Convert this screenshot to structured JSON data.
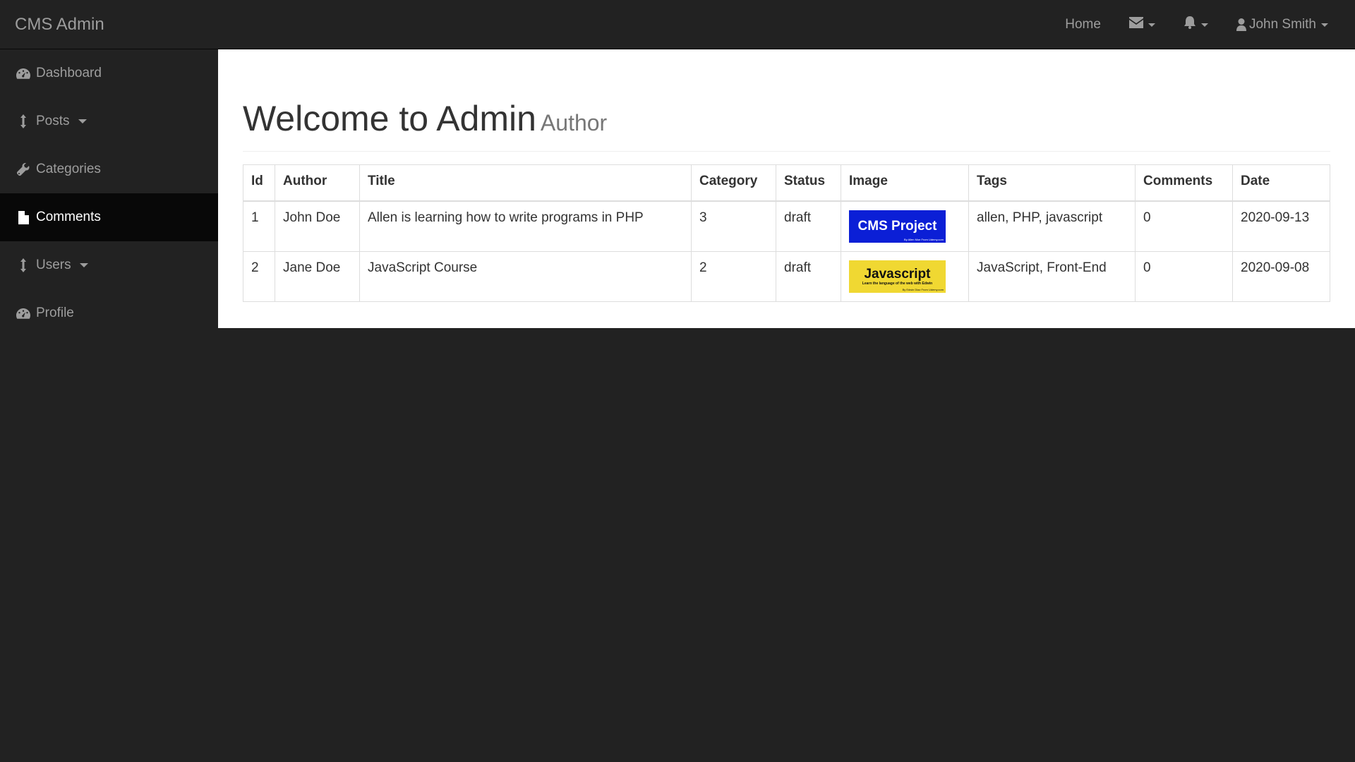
{
  "navbar": {
    "brand": "CMS Admin",
    "home": "Home",
    "messages_icon": "envelope-icon",
    "alerts_icon": "bell-icon",
    "user_icon": "user-icon",
    "user_name": "John Smith"
  },
  "sidebar": {
    "items": [
      {
        "label": "Dashboard",
        "icon": "dashboard-icon",
        "dropdown": false,
        "active": false
      },
      {
        "label": "Posts",
        "icon": "arrows-v-icon",
        "dropdown": true,
        "active": false
      },
      {
        "label": "Categories",
        "icon": "wrench-icon",
        "dropdown": false,
        "active": false
      },
      {
        "label": "Comments",
        "icon": "file-icon",
        "dropdown": false,
        "active": true
      },
      {
        "label": "Users",
        "icon": "arrows-v-icon",
        "dropdown": true,
        "active": false
      },
      {
        "label": "Profile",
        "icon": "dashboard-icon",
        "dropdown": false,
        "active": false
      }
    ]
  },
  "page": {
    "title": "Welcome to Admin",
    "subtitle": "Author"
  },
  "table": {
    "headers": [
      "Id",
      "Author",
      "Title",
      "Category",
      "Status",
      "Image",
      "Tags",
      "Comments",
      "Date"
    ],
    "rows": [
      {
        "id": "1",
        "author": "John Doe",
        "title": "Allen is learning how to write programs in PHP",
        "category": "3",
        "status": "draft",
        "image": {
          "title": "CMS Project",
          "sub": "",
          "tiny": "By Allen Moe From Udemy.com",
          "color": "#0b1fd6"
        },
        "tags": "allen, PHP, javascript",
        "comments": "0",
        "date": "2020-09-13"
      },
      {
        "id": "2",
        "author": "Jane Doe",
        "title": "JavaScript Course",
        "category": "2",
        "status": "draft",
        "image": {
          "title": "Javascript",
          "sub": "Learn the language of the web with Edwin",
          "tiny": "By Edwin Diaz From Udemy.com",
          "color": "#f0d832"
        },
        "tags": "JavaScript, Front-End",
        "comments": "0",
        "date": "2020-09-08"
      }
    ]
  },
  "colors": {
    "navbar_bg": "#222222",
    "sidebar_active_bg": "#080808",
    "content_bg": "#ffffff"
  }
}
